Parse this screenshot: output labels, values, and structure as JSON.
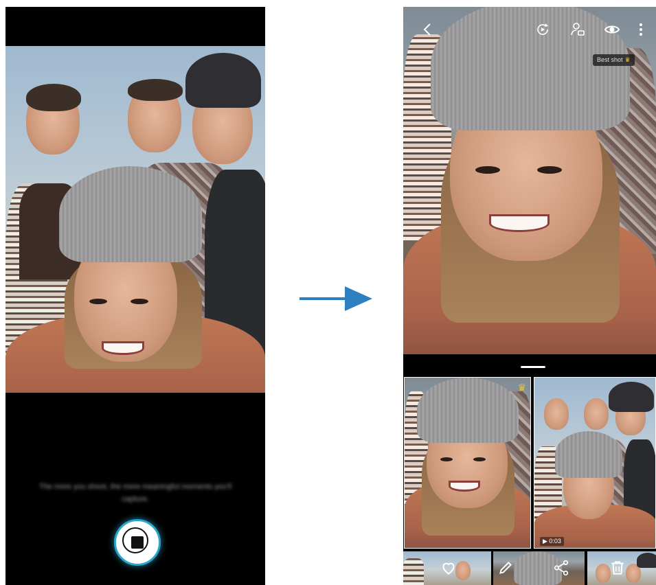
{
  "left_screen": {
    "caption": "The more you shoot, the more meaningful moments you'll capture."
  },
  "right_screen": {
    "top_bar": {
      "back_icon": "chevron-left-icon",
      "refresh_icon": "rotate-play-icon",
      "people_icon": "person-tag-icon",
      "view_icon": "eye-icon",
      "more_icon": "more-vertical-icon"
    },
    "best_shot_label": "Best shot",
    "thumbnails": [
      {
        "kind": "photo",
        "best": true
      },
      {
        "kind": "video",
        "duration": "0:03"
      }
    ],
    "bottom_actions": [
      {
        "name": "favorite",
        "icon": "heart-icon"
      },
      {
        "name": "edit",
        "icon": "pencil-icon"
      },
      {
        "name": "share",
        "icon": "share-icon"
      },
      {
        "name": "delete",
        "icon": "trash-icon"
      }
    ]
  },
  "colors": {
    "accent_ring": "#2aa6c9",
    "arrow": "#2e7fc0",
    "crown": "#f5c518"
  }
}
